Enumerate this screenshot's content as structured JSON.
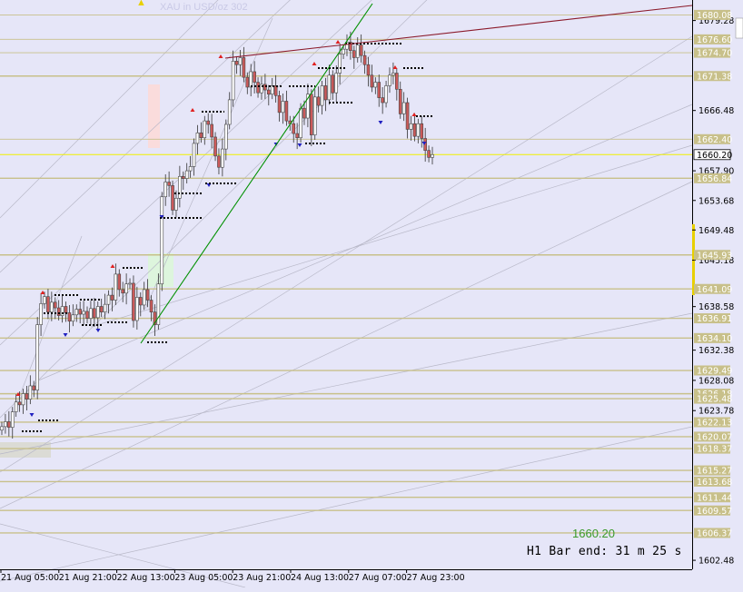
{
  "chart_data": {
    "type": "candlestick",
    "symbol_label": "XAU in USD/oz 302",
    "timeframe": "H1",
    "current_price": "1660.20",
    "bar_timer": "H1 Bar end: 31 m 25 s",
    "ylim": [
      1601.2,
      1682.2
    ],
    "y_ticks": [
      "1679.28",
      "1666.48",
      "1657.90",
      "1653.68",
      "1649.48",
      "1645.18",
      "1638.58",
      "1632.38",
      "1628.08",
      "1623.78",
      "1602.48"
    ],
    "x_ticks": [
      "21 Aug 05:00",
      "21 Aug 21:00",
      "22 Aug 13:00",
      "23 Aug 05:00",
      "23 Aug 21:00",
      "24 Aug 13:00",
      "27 Aug 07:00",
      "27 Aug 23:00"
    ],
    "levels": [
      {
        "label": "1680.08",
        "style": "solid"
      },
      {
        "label": "1676.60",
        "style": "solid"
      },
      {
        "label": "1674.70",
        "style": "solid"
      },
      {
        "label": "1671.38",
        "style": "thick"
      },
      {
        "label": "1662.40",
        "style": "solid"
      },
      {
        "label": "1660.20",
        "style": "current"
      },
      {
        "label": "1656.84",
        "style": "thick"
      },
      {
        "label": "1645.93",
        "style": "thick"
      },
      {
        "label": "1641.09",
        "style": "thick"
      },
      {
        "label": "1636.91",
        "style": "thick"
      },
      {
        "label": "1634.10",
        "style": "thick"
      },
      {
        "label": "1629.49",
        "style": "thick"
      },
      {
        "label": "1626.18",
        "style": "thick"
      },
      {
        "label": "1625.48",
        "style": "thick"
      },
      {
        "label": "1622.13",
        "style": "thick"
      },
      {
        "label": "1620.07",
        "style": "thick"
      },
      {
        "label": "1618.37",
        "style": "thick"
      },
      {
        "label": "1615.27",
        "style": "thick"
      },
      {
        "label": "1613.68",
        "style": "thick"
      },
      {
        "label": "1611.44",
        "style": "thick"
      },
      {
        "label": "1609.57",
        "style": "thick"
      },
      {
        "label": "1606.37",
        "style": "thick"
      }
    ],
    "colors": {
      "background": "#E6E6F8",
      "bull": "#FFFFFF",
      "bear": "#CC5A5A",
      "level": "#C8C08A",
      "current": "#F0F000",
      "trend_up": "#009000",
      "trend_resist": "#8B1A2A"
    }
  }
}
